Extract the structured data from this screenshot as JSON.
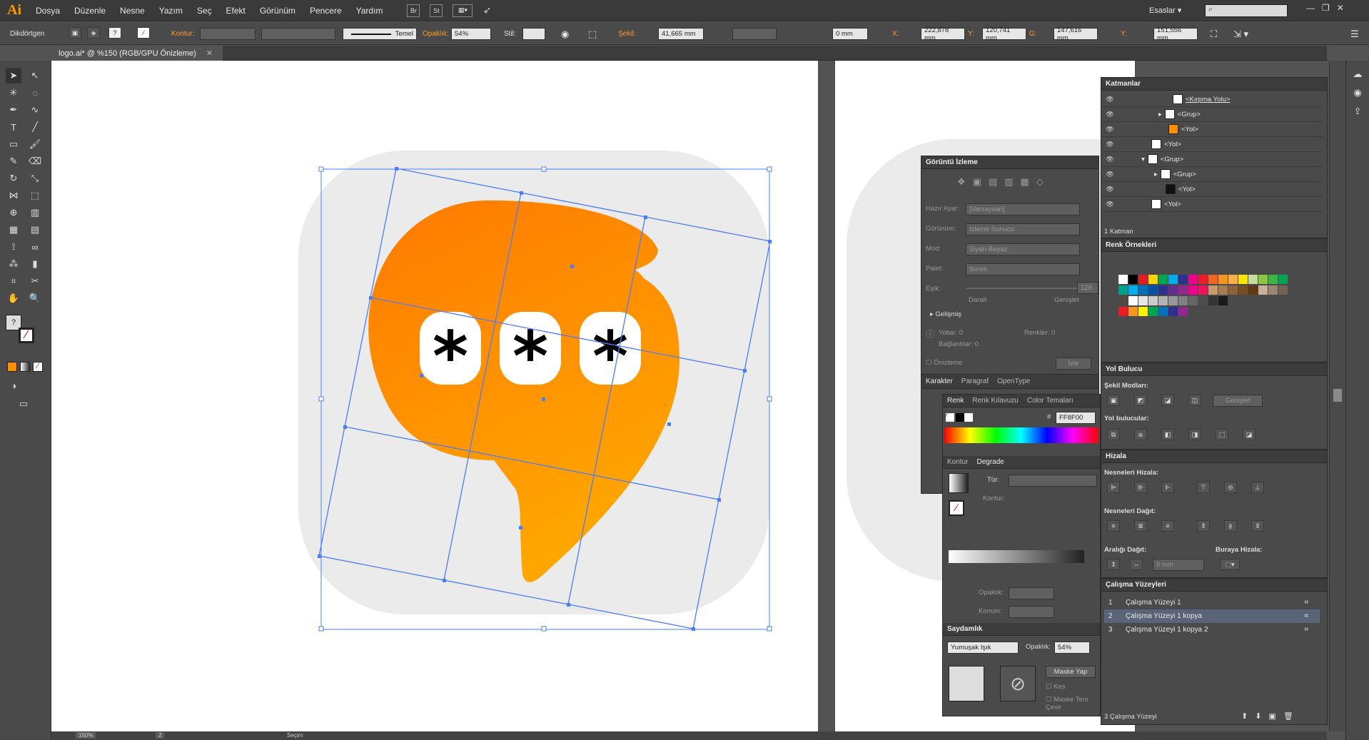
{
  "app": {
    "logo": "Ai",
    "workspace": "Esaslar"
  },
  "menu": [
    "Dosya",
    "Düzenle",
    "Nesne",
    "Yazım",
    "Seç",
    "Efekt",
    "Görünüm",
    "Pencere",
    "Yardım"
  ],
  "menu_buttons": [
    "Br",
    "St"
  ],
  "control": {
    "tool_name": "Dikdörtgen",
    "stroke_label": "Kontur:",
    "stroke_profile": "Temel",
    "opacity_label": "Opaklık:",
    "opacity": "54%",
    "style_label": "Stil:",
    "shape_label": "Şekil:",
    "shape_w": "41,665 mm",
    "corner": "0 mm",
    "x_label": "X:",
    "x": "222,878 mm",
    "y_label": "Y:",
    "y": "120,741 mm",
    "g_label": "G:",
    "g": "147,616 mm",
    "h_label": "Y:",
    "h": "151,556 mm"
  },
  "document": {
    "tab": "logo.ai* @ %150 (RGB/GPU Önizleme)",
    "zoom": "150%",
    "page": "2",
    "status": "Seçim"
  },
  "layers": {
    "title": "Katmanlar",
    "rows": [
      "<Kırpma Yolu>",
      "<Grup>",
      "<Yol>",
      "<Yol>",
      "<Grup>",
      "<Grup>",
      "<Yol>",
      "<Yol>"
    ],
    "footer": "1 Katman"
  },
  "swatches": {
    "title": "Renk Örnekleri"
  },
  "image_trace": {
    "title": "Görüntü İzleme",
    "preset_label": "Hazır Ayar:",
    "preset": "[Varsayılan]",
    "view_label": "Görünüm:",
    "view": "İzleme Sonucu",
    "mode_label": "Mod:",
    "mode": "Siyah-Beyaz",
    "palette_label": "Palet:",
    "palette": "Sınırlı",
    "threshold_label": "Eşik:",
    "threshold": "128",
    "less": "Daralt",
    "more": "Genişlet",
    "advanced": "Gelişmiş",
    "paths_label": "Yollar:",
    "paths": "0",
    "colors_label": "Renkler:",
    "colors": "0",
    "anchors_label": "Bağlantılar:",
    "anchors": "0",
    "preview": "Önizleme",
    "trace": "İzle"
  },
  "character_tabs": [
    "Karakter",
    "Paragraf",
    "OpenType"
  ],
  "color_tabs": [
    "Renk",
    "Renk Kılavuzu",
    "Color Temaları"
  ],
  "color": {
    "hex_label": "#",
    "hex": "FF8F00"
  },
  "stroke_tabs": [
    "Kontur",
    "Degrade"
  ],
  "gradient": {
    "type_label": "Tür:",
    "stroke_label": "Kontur:",
    "opacity_label": "Opaklık:",
    "location_label": "Konum:"
  },
  "transparency": {
    "title": "Saydamlık",
    "blend": "Yumuşak Işık",
    "opacity_label": "Opaklık:",
    "opacity": "54%",
    "make_mask": "Maske Yap",
    "clip": "Kes",
    "invert": "Maske Ters Çevir"
  },
  "pathfinder": {
    "title": "Yol Bulucu",
    "shape_modes": "Şekil Modları:",
    "expand": "Genişlet",
    "pathfinders": "Yol bulucular:"
  },
  "align": {
    "title": "Hizala",
    "align_objects": "Nesneleri Hizala:",
    "distribute_objects": "Nesneleri Dağıt:",
    "distribute_spacing": "Aralığı Dağıt:",
    "align_to": "Buraya Hizala:",
    "spacing": "0 mm"
  },
  "artboards": {
    "title": "Çalışma Yüzeyleri",
    "rows": [
      {
        "num": "1",
        "name": "Çalışma Yüzeyi 1"
      },
      {
        "num": "2",
        "name": "Çalışma Yüzeyi 1 kopya"
      },
      {
        "num": "3",
        "name": "Çalışma Yüzeyi 1 kopya 2"
      }
    ],
    "footer": "3 Çalışma Yüzeyi"
  },
  "artwork": {
    "glyphs": [
      "*",
      "*",
      "*"
    ]
  },
  "colors": {
    "accent": "#ff8f00",
    "orange_top": "#ff7a00",
    "orange_bottom": "#ffa600",
    "selection": "#4a7cff",
    "bg_shape": "#ebebeb"
  }
}
